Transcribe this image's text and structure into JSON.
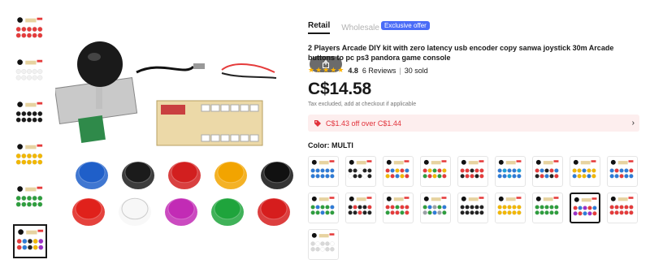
{
  "thumbnails": [
    {
      "name": "red-kit"
    },
    {
      "name": "white-kit"
    },
    {
      "name": "black-kit"
    },
    {
      "name": "yellow-kit"
    },
    {
      "name": "green-kit"
    },
    {
      "name": "multi-kit",
      "selected": true
    }
  ],
  "product": {
    "tabs": {
      "retail": "Retail",
      "wholesale": "Wholesale",
      "exclusive_badge": "Exclusive offer"
    },
    "title": "2 Players Arcade DIY kit with zero latency usb encoder copy sanwa joystick 30m Arcade buttons to pc ps3 pandora game console",
    "rating": {
      "stars": "★★★★★",
      "score": "4.8",
      "reviews": "6 Reviews",
      "sold": "30 sold"
    },
    "price": "C$14.58",
    "tax_note": "Tax excluded, add at checkout if applicable",
    "promo": "C$1.43 off over C$1.44",
    "color_label": "Color: MULTI"
  },
  "swatches": [
    {
      "colors": [
        "#2e7bd6",
        "#2e7bd6",
        "#2e7bd6"
      ]
    },
    {
      "colors": [
        "#222222",
        "#222222",
        "#ffffff"
      ]
    },
    {
      "colors": [
        "#e53b3b",
        "#2e7bd6",
        "#f2b701"
      ]
    },
    {
      "colors": [
        "#e53b3b",
        "#f2b701",
        "#2e9e3e"
      ]
    },
    {
      "colors": [
        "#e53b3b",
        "#e53b3b",
        "#222222"
      ]
    },
    {
      "colors": [
        "#2e7bd6",
        "#1f9fd6",
        "#2e7bd6"
      ]
    },
    {
      "colors": [
        "#e53b3b",
        "#2e7bd6",
        "#222222"
      ]
    },
    {
      "colors": [
        "#f2b701",
        "#f2b701",
        "#2e7bd6"
      ]
    },
    {
      "colors": [
        "#2e7bd6",
        "#e53b3b",
        "#2e7bd6"
      ]
    },
    {
      "colors": [
        "#2e9e3e",
        "#2e7bd6",
        "#2e9e3e"
      ]
    },
    {
      "colors": [
        "#222222",
        "#e53b3b",
        "#222222"
      ]
    },
    {
      "colors": [
        "#e53b3b",
        "#e53b3b",
        "#2e9e3e"
      ]
    },
    {
      "colors": [
        "#2e9e3e",
        "#2e7bd6",
        "#9aa0a6"
      ]
    },
    {
      "colors": [
        "#222222",
        "#222222",
        "#222222"
      ]
    },
    {
      "colors": [
        "#f2b701",
        "#f2b701",
        "#f2b701"
      ]
    },
    {
      "colors": [
        "#2e9e3e",
        "#2e9e3e",
        "#2e9e3e"
      ]
    },
    {
      "colors": [
        "#e53b3b",
        "#2e7bd6",
        "#9b30c8"
      ],
      "selected": true
    },
    {
      "colors": [
        "#e53b3b",
        "#e53b3b",
        "#e53b3b"
      ]
    },
    {
      "colors": [
        "#d8d8d8",
        "#ffffff",
        "#d8d8d8"
      ]
    }
  ],
  "icons": {
    "share": "share-icon",
    "promo": "tag-icon",
    "chevron": "chevron-right-icon"
  },
  "main_buttons": [
    "#1f5fc9",
    "#1b1b1b",
    "#d21f1f",
    "#f2a400",
    "#111111",
    "#e0211b",
    "#f7f7f7",
    "#c22bb5",
    "#1fa43c",
    "#d61d1d"
  ]
}
